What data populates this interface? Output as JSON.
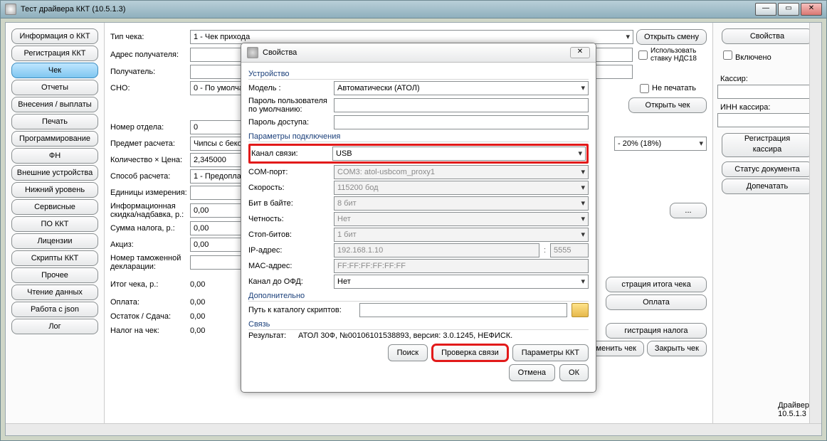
{
  "window": {
    "title": "Тест драйвера ККТ (10.5.1.3)"
  },
  "sidebar": {
    "items": [
      {
        "label": "Информация о ККТ"
      },
      {
        "label": "Регистрация ККТ"
      },
      {
        "label": "Чек"
      },
      {
        "label": "Отчеты"
      },
      {
        "label": "Внесения / выплаты"
      },
      {
        "label": "Печать"
      },
      {
        "label": "Программирование"
      },
      {
        "label": "ФН"
      },
      {
        "label": "Внешние устройства"
      },
      {
        "label": "Нижний уровень"
      },
      {
        "label": "Сервисные"
      },
      {
        "label": "ПО ККТ"
      },
      {
        "label": "Лицензии"
      },
      {
        "label": "Скрипты ККТ"
      },
      {
        "label": "Прочее"
      },
      {
        "label": "Чтение данных"
      },
      {
        "label": "Работа с json"
      },
      {
        "label": "Лог"
      }
    ],
    "selected_index": 2
  },
  "mid": {
    "check_type_label": "Тип чека:",
    "check_type_value": "1 - Чек прихода",
    "recipient_addr_label": "Адрес получателя:",
    "recipient_addr_value": "",
    "recipient_label": "Получатель:",
    "recipient_value": "",
    "sno_label": "СНО:",
    "sno_value": "0 - По умолчани",
    "dept_label": "Номер отдела:",
    "dept_value": "0",
    "subject_label": "Предмет расчета:",
    "subject_value": "Чипсы с бекон",
    "qtyprice_label": "Количество × Цена:",
    "qtyprice_value": "2,345000",
    "calc_method_label": "Способ расчета:",
    "calc_method_value": "1 - Предоплат",
    "unit_label": "Единицы измерения:",
    "unit_value": "",
    "discount_label": "Информационная\nскидка/надбавка, р.:",
    "discount_value": "0,00",
    "taxsum_label": "Сумма налога, р.:",
    "taxsum_value": "0,00",
    "excise_label": "Акциз:",
    "excise_value": "0,00",
    "customs_label": "Номер таможенной\nдекларации:",
    "total_label": "Итог чека, р.:",
    "total_value": "0,00",
    "payment_label": "Оплата:",
    "payment_value": "0,00",
    "rest_label": "Остаток / Сдача:",
    "rest_value": "0,00",
    "taxcheck_label": "Налог на чек:",
    "taxcheck_value": "0,00"
  },
  "right_top": {
    "open_shift": "Открыть смену",
    "use_vat18": "Использовать\nставку НДС18",
    "no_print": "Не печатать",
    "open_check": "Открыть чек",
    "vat_option": "- 20% (18%)"
  },
  "right_mid": {
    "reg_total": "страция итога чека",
    "payment": "Оплата",
    "reg_tax": "гистрация налога",
    "cancel_check": "Отменить чек",
    "close_check": "Закрыть чек"
  },
  "rpanel": {
    "props": "Свойства",
    "enabled": "Включено",
    "cashier_label": "Кассир:",
    "inn_label": "ИНН кассира:",
    "reg_cashier": "Регистрация\nкассира",
    "doc_status": "Статус документа",
    "reprint": "Допечатать",
    "driver_label": "Драйвер:",
    "driver_ver": "10.5.1.3"
  },
  "dialog": {
    "title": "Свойства",
    "group_device": "Устройство",
    "model_label": "Модель :",
    "model_value": "Автоматически (АТОЛ)",
    "userpw_label": "Пароль пользователя\nпо умолчанию:",
    "userpw_value": "",
    "accesspw_label": "Пароль доступа:",
    "accesspw_value": "",
    "group_conn": "Параметры подключения",
    "channel_label": "Канал связи:",
    "channel_value": "USB",
    "com_label": "COM-порт:",
    "com_value": "COM3: atol-usbcom_proxy1",
    "speed_label": "Скорость:",
    "speed_value": "115200 бод",
    "bits_label": "Бит в байте:",
    "bits_value": "8 бит",
    "parity_label": "Четность:",
    "parity_value": "Нет",
    "stop_label": "Стоп-битов:",
    "stop_value": "1 бит",
    "ip_label": "IP-адрес:",
    "ip_value": "192.168.1.10",
    "ip_port": "5555",
    "mac_label": "MAC-адрес:",
    "mac_value": "FF:FF:FF:FF:FF:FF",
    "ofd_label": "Канал до ОФД:",
    "ofd_value": "Нет",
    "group_extra": "Дополнительно",
    "scripts_label": "Путь к каталогу скриптов:",
    "group_link": "Связь",
    "result_label": "Результат:",
    "result_value": "АТОЛ 30Ф, №00106101538893, версия: 3.0.1245, НЕФИСК.",
    "btn_search": "Поиск",
    "btn_check": "Проверка связи",
    "btn_params": "Параметры ККТ",
    "btn_cancel": "Отмена",
    "btn_ok": "ОК"
  }
}
